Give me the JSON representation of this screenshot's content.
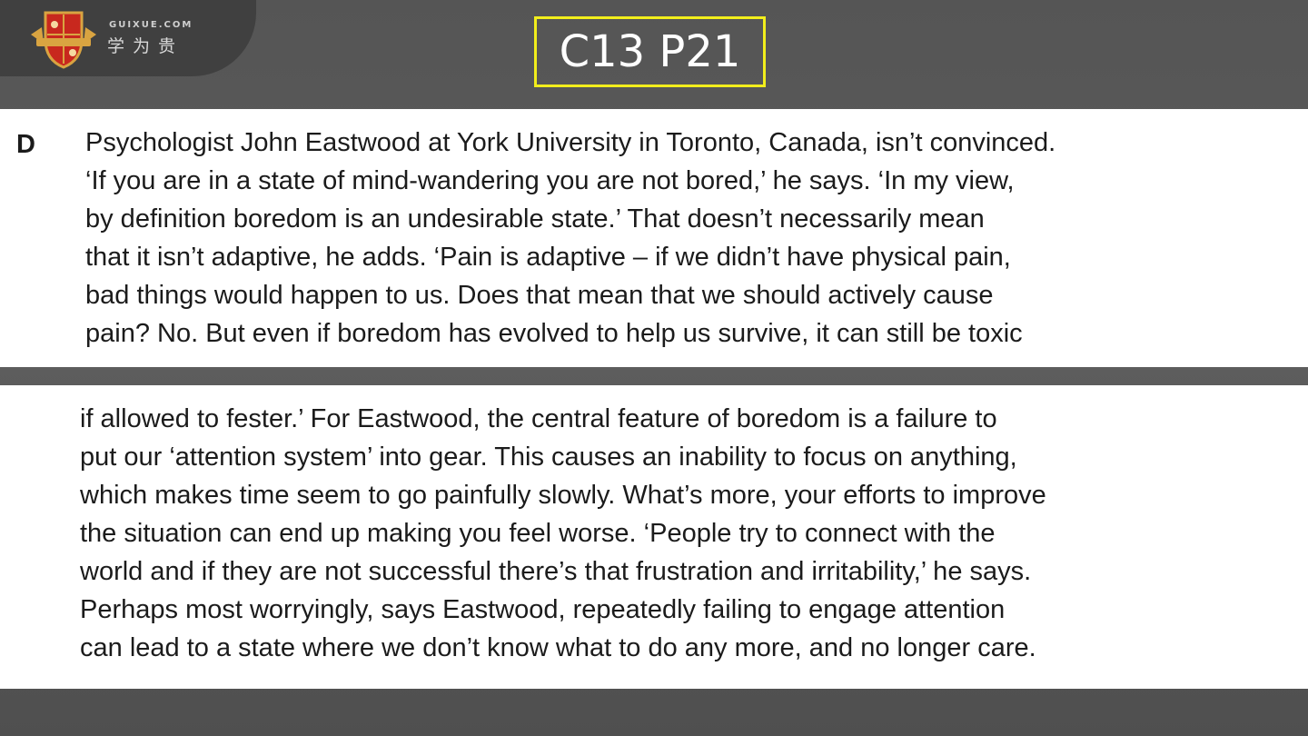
{
  "brand": {
    "domain": "GUIXUE.COM",
    "name_cn": "学为贵"
  },
  "slide_title": "C13 P21",
  "passage": {
    "paragraph_letter": "D",
    "top_lines": [
      "Psychologist John Eastwood at York University in Toronto, Canada, isn’t convinced.",
      "‘If you are in a state of mind-wandering you are not bored,’ he says. ‘In my view,",
      "by definition boredom is an undesirable state.’ That doesn’t necessarily mean",
      "that it isn’t adaptive, he adds. ‘Pain is adaptive – if we didn’t have physical pain,",
      "bad things would happen to us. Does that mean that we should actively cause",
      "pain? No. But even if boredom has evolved to help us survive, it can still be toxic"
    ],
    "bottom_lines": [
      "if allowed to fester.’ For Eastwood, the central feature of boredom is a failure to",
      "put our ‘attention system’ into gear. This causes an inability to focus on anything,",
      "which makes time seem to go painfully slowly. What’s more, your efforts to improve",
      "the situation can end up making you feel worse. ‘People try to connect with the",
      "world and if they are not successful there’s that frustration and irritability,’ he says.",
      "Perhaps most worryingly, says Eastwood, repeatedly failing to engage attention",
      "can lead to a state where we don’t know what to do any more, and no longer care."
    ]
  },
  "colors": {
    "title_border": "#f2ee1c",
    "crest_red": "#c8281e",
    "crest_gold": "#d9a441"
  }
}
